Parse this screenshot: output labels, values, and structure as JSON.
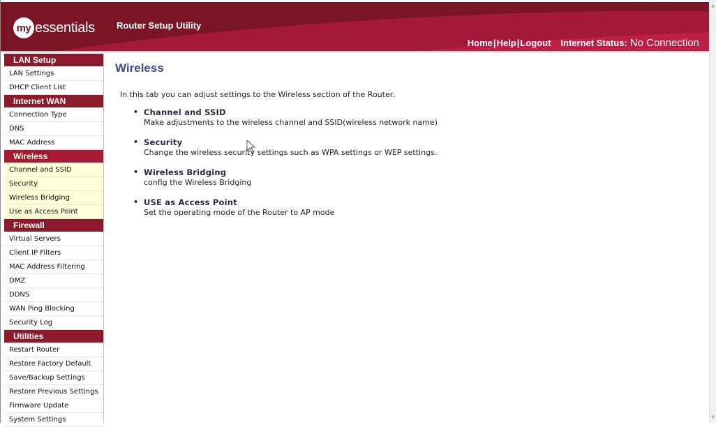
{
  "header": {
    "logo_my": "my",
    "logo_rest": "essentials",
    "app_title": "Router Setup Utility",
    "nav": {
      "home": "Home",
      "help": "Help",
      "logout": "Logout",
      "sep": "|"
    },
    "status_label": "Internet Status:",
    "status_value": "No Connection"
  },
  "sidebar": {
    "sections": [
      {
        "title": "LAN Setup",
        "items": [
          "LAN Settings",
          "DHCP Client List"
        ]
      },
      {
        "title": "Internet WAN",
        "items": [
          "Connection Type",
          "DNS",
          "MAC Address"
        ]
      },
      {
        "title": "Wireless",
        "items": [
          "Channel and SSID",
          "Security",
          "Wireless Bridging",
          "Use as Access Point"
        ]
      },
      {
        "title": "Firewall",
        "items": [
          "Virtual Servers",
          "Client IP Filters",
          "MAC Address Filtering",
          "DMZ",
          "DDNS",
          "WAN Ping Blocking",
          "Security Log"
        ]
      },
      {
        "title": "Utilities",
        "items": [
          "Restart Router",
          "Restore Factory Default",
          "Save/Backup Settings",
          "Restore Previous Settings",
          "Firmware Update",
          "System Settings"
        ]
      }
    ]
  },
  "main": {
    "title": "Wireless",
    "intro": "In this tab you can adjust settings to the Wireless section of the Router.",
    "bullet": "•",
    "options": [
      {
        "title": "Channel and SSID",
        "desc": "Make adjustments to the wireless channel and SSID(wireless network name)"
      },
      {
        "title": "Security",
        "desc": "Change the wireless security settings such as WPA settings or WEP settings."
      },
      {
        "title": "Wireless Bridging",
        "desc": "config the Wireless Bridging"
      },
      {
        "title": "USE as Access Point",
        "desc": "Set the operating mode of the Router to AP mode"
      }
    ]
  },
  "colors": {
    "header": "#7a1526",
    "section_head": "#8c1a2a",
    "active_section": "#a81a34",
    "highlight_bg": "#ffffd8",
    "title": "#3d4c8a"
  },
  "icons": {
    "cursor": "mouse-pointer-icon",
    "scroll_up": "scroll-up-arrow-icon",
    "scroll_down": "scroll-down-arrow-icon"
  }
}
